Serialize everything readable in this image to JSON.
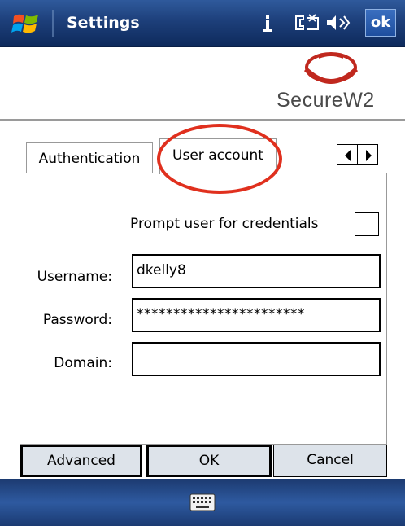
{
  "title_bar": {
    "title": "Settings",
    "ok_label": "ok",
    "icons": [
      "windows-start-icon",
      "signal-icon",
      "phone-icon",
      "volume-icon"
    ]
  },
  "header": {
    "logo_text": "SecureW2",
    "logo_color": "#c0281e"
  },
  "tabs": [
    {
      "label": "Authentication",
      "active": false
    },
    {
      "label": "User account",
      "active": true
    }
  ],
  "tab_scroll": {
    "prev_icon": "arrow-left-icon",
    "next_icon": "arrow-right-icon"
  },
  "form": {
    "prompt_label": "Prompt user for credentials",
    "prompt_checked": false,
    "username_label": "Username:",
    "username_value": "dkelly8",
    "password_label": "Password:",
    "password_value": "***********************",
    "domain_label": "Domain:",
    "domain_value": ""
  },
  "buttons": {
    "advanced": "Advanced",
    "ok": "OK",
    "cancel": "Cancel"
  },
  "softkey": {
    "icon": "keyboard-icon"
  },
  "colors": {
    "titlebar": "#1d3f7a",
    "highlight_ring": "#e0301e",
    "button_face": "#dde3ea"
  }
}
